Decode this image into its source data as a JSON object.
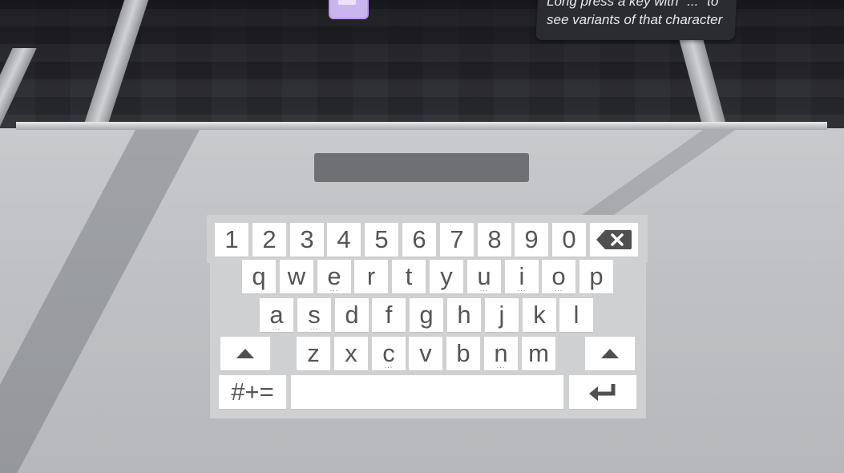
{
  "tooltip": {
    "line1": "Long press a key with \"...\" to",
    "line2": "see variants of that character"
  },
  "keyboard": {
    "row_numbers": [
      "1",
      "2",
      "3",
      "4",
      "5",
      "6",
      "7",
      "8",
      "9",
      "0"
    ],
    "row_top": [
      "q",
      "w",
      "e",
      "r",
      "t",
      "y",
      "u",
      "i",
      "o",
      "p"
    ],
    "row_middle": [
      "a",
      "s",
      "d",
      "f",
      "g",
      "h",
      "j",
      "k",
      "l"
    ],
    "row_bottom": [
      "z",
      "x",
      "c",
      "v",
      "b",
      "n",
      "m"
    ],
    "symbols_label": "#+=",
    "variant_indicator": "...",
    "keys_with_variants": [
      "e",
      "u",
      "i",
      "o",
      "a",
      "s",
      "c",
      "n"
    ]
  },
  "icons": {
    "backspace": "backspace-icon",
    "shift_left": "shift-icon",
    "shift_right": "shift-icon",
    "enter": "enter-icon"
  }
}
